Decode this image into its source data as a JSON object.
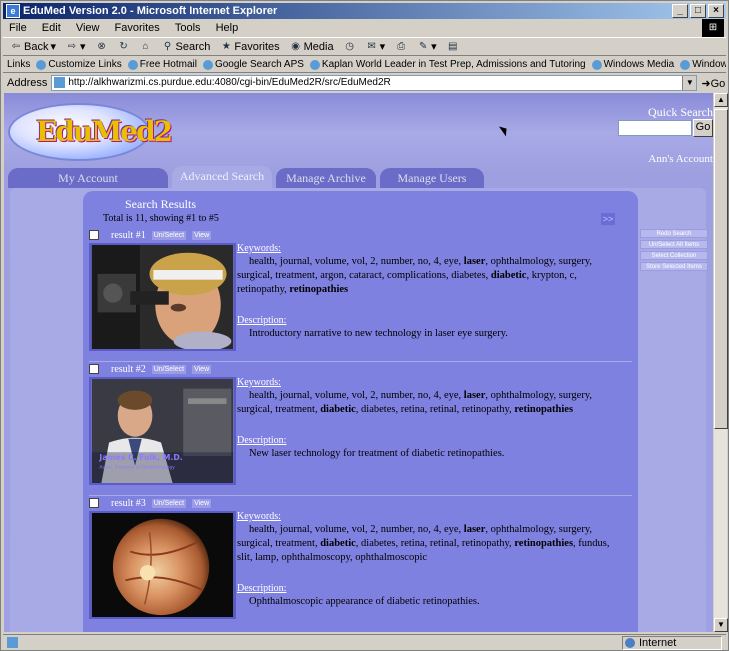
{
  "window": {
    "title": "EduMed Version 2.0 - Microsoft Internet Explorer",
    "controls": [
      "_",
      "□",
      "×"
    ]
  },
  "menu": [
    "File",
    "Edit",
    "View",
    "Favorites",
    "Tools",
    "Help"
  ],
  "toolbar": {
    "back": "Back",
    "search": "Search",
    "favorites": "Favorites",
    "media": "Media"
  },
  "links": {
    "label": "Links",
    "items": [
      "Customize Links",
      "Free Hotmail",
      "Google Search APS",
      "Kaplan World Leader in Test Prep, Admissions and Tutoring",
      "Windows Media",
      "Windows"
    ]
  },
  "address": {
    "label": "Address",
    "url": "http://alkhwarizmi.cs.purdue.edu:4080/cgi-bin/EduMed2R/src/EduMed2R",
    "go": "Go"
  },
  "page": {
    "logo_text": "EduMed2",
    "quick_search_label": "Quick Search",
    "quick_search_go": "Go",
    "account": "Ann's Account",
    "tabs": [
      "My Account",
      "Advanced Search",
      "Manage Archive",
      "Manage Users"
    ],
    "results_title": "Search Results",
    "results_total": "Total is 11, showing #1 to #5",
    "next": ">>",
    "side_buttons": [
      "Redo Search",
      "Un/Select All Items",
      "Select Collection",
      "Store Selected Items"
    ],
    "keywords_label": "Keywords:",
    "description_label": "Description:",
    "unselect_label": "Un/Select",
    "view_label": "View",
    "results": [
      {
        "label": "result #1",
        "keywords_parts": [
          {
            "t": "health, journal, volume, vol, 2, number, no, 4, eye, ",
            "b": false
          },
          {
            "t": "laser",
            "b": true
          },
          {
            "t": ", ophthalmology, surgery, surgical, treatment, argon, cataract, complications, diabetes, ",
            "b": false
          },
          {
            "t": "diabetic",
            "b": true
          },
          {
            "t": ", krypton, c, retinopathy, ",
            "b": false
          },
          {
            "t": "retinopathies",
            "b": true
          }
        ],
        "description": "Introductory narrative to new technology in laser eye surgery."
      },
      {
        "label": "result #2",
        "keywords_parts": [
          {
            "t": "health, journal, volume, vol, 2, number, no, 4, eye, ",
            "b": false
          },
          {
            "t": "laser",
            "b": true
          },
          {
            "t": ", ophthalmology, surgery, surgical, treatment, ",
            "b": false
          },
          {
            "t": "diabetic",
            "b": true
          },
          {
            "t": ", diabetes, retina, retinal, retinopathy, ",
            "b": false
          },
          {
            "t": "retinopathies",
            "b": true
          }
        ],
        "description": "New laser technology for treatment of diabetic retinopathies.",
        "caption_name": "James C. Folk, M.D.",
        "caption_sub": "Assoc. Professor of Ophthalmology"
      },
      {
        "label": "result #3",
        "keywords_parts": [
          {
            "t": "health, journal, volume, vol, 2, number, no, 4, eye, ",
            "b": false
          },
          {
            "t": "laser",
            "b": true
          },
          {
            "t": ", ophthalmology, surgery, surgical, treatment, ",
            "b": false
          },
          {
            "t": "diabetic",
            "b": true
          },
          {
            "t": ", diabetes, retina, retinal, retinopathy, ",
            "b": false
          },
          {
            "t": "retinopathies",
            "b": true
          },
          {
            "t": ", fundus, slit, lamp, ophthalmoscopy, ophthalmoscopic",
            "b": false
          }
        ],
        "description": "Ophthalmoscopic appearance of diabetic retinopathies."
      }
    ]
  },
  "status": {
    "zone": "Internet"
  }
}
